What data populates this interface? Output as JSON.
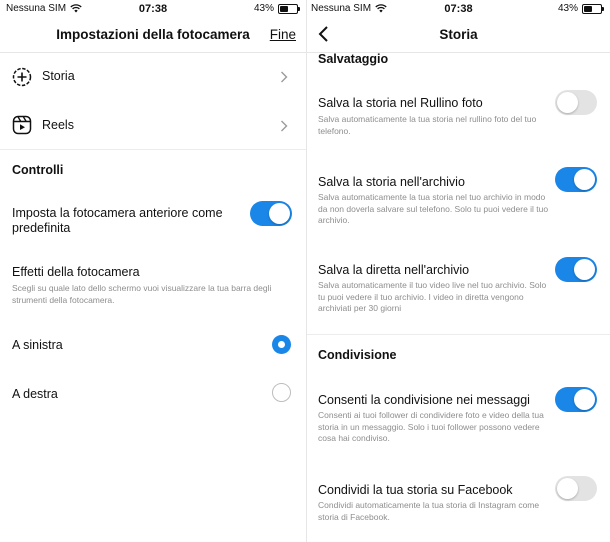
{
  "left": {
    "status": {
      "carrier": "Nessuna SIM",
      "time": "07:38",
      "battery": "43%"
    },
    "title": "Impostazioni della fotocamera",
    "done": "Fine",
    "nav_items": [
      {
        "label": "Storia",
        "icon": "add-circle-icon"
      },
      {
        "label": "Reels",
        "icon": "reels-icon"
      }
    ],
    "controls": {
      "title": "Controlli",
      "front_camera": {
        "label": "Imposta la fotocamera anteriore come predefinita",
        "enabled": true
      },
      "effects": {
        "title": "Effetti della fotocamera",
        "desc": "Scegli su quale lato dello schermo vuoi visualizzare la tua barra degli strumenti della fotocamera."
      },
      "options": [
        {
          "label": "A sinistra",
          "selected": true
        },
        {
          "label": "A destra",
          "selected": false
        }
      ]
    }
  },
  "right": {
    "status": {
      "carrier": "Nessuna SIM",
      "time": "07:38",
      "battery": "43%"
    },
    "title": "Storia",
    "saving": {
      "title": "Salvataggio",
      "items": [
        {
          "title": "Salva la storia nel Rullino foto",
          "desc": "Salva automaticamente la tua storia nel rullino foto del tuo telefono.",
          "enabled": false
        },
        {
          "title": "Salva la storia nell'archivio",
          "desc": "Salva automaticamente la tua storia nel tuo archivio in modo da non doverla salvare sul telefono. Solo tu puoi vedere il tuo archivio.",
          "enabled": true
        },
        {
          "title": "Salva la diretta nell'archivio",
          "desc": "Salva automaticamente il tuo video live nel tuo archivio. Solo tu puoi vedere il tuo archivio. I video in diretta vengono archiviati per 30 giorni",
          "enabled": true
        }
      ]
    },
    "sharing": {
      "title": "Condivisione",
      "items": [
        {
          "title": "Consenti la condivisione nei messaggi",
          "desc": "Consenti ai tuoi follower di condividere foto e video della tua storia in un messaggio. Solo i tuoi follower possono vedere cosa hai condiviso.",
          "enabled": true
        },
        {
          "title": "Condividi la tua storia su Facebook",
          "desc": "Condividi automaticamente la tua storia di Instagram come storia di Facebook.",
          "enabled": false
        }
      ]
    }
  },
  "colors": {
    "accent": "#1a86e8",
    "toggle_off": "#e3e3e3",
    "muted_text": "#8e8e8e"
  },
  "battery_level": 0.43
}
